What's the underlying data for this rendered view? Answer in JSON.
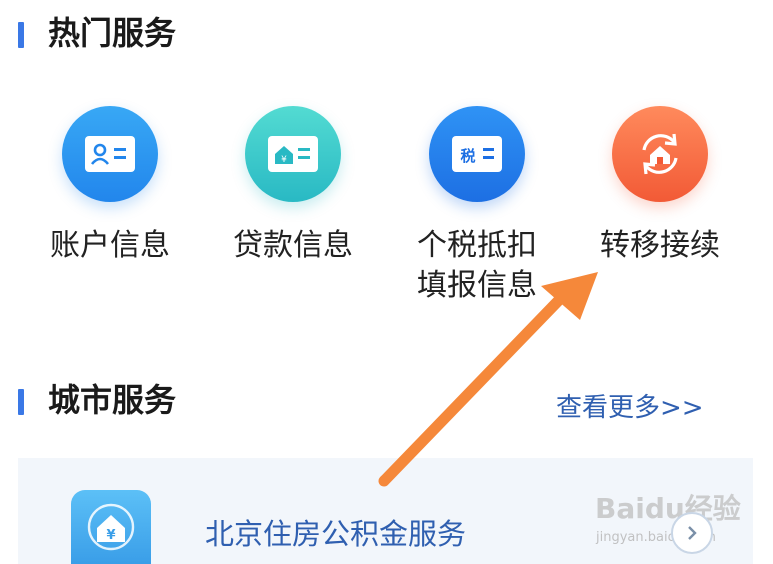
{
  "hot_services": {
    "title": "热门服务",
    "items": [
      {
        "label_lines": [
          "账户信息"
        ],
        "icon": "id-card-icon",
        "color_top": "#38a8f5",
        "color_bottom": "#2286ec"
      },
      {
        "label_lines": [
          "贷款信息"
        ],
        "icon": "loan-card-icon",
        "color_top": "#53dbd2",
        "color_bottom": "#29b9c4"
      },
      {
        "label_lines": [
          "个税抵扣",
          "填报信息"
        ],
        "icon": "tax-card-icon",
        "color_top": "#2f93f5",
        "color_bottom": "#1d6fe3"
      },
      {
        "label_lines": [
          "转移接续"
        ],
        "icon": "transfer-house-icon",
        "color_top": "#ff8a5c",
        "color_bottom": "#f25a36"
      }
    ]
  },
  "city_services": {
    "title": "城市服务",
    "more_link": "查看更多>>",
    "card_label": "北京住房公积金服务",
    "card_icon": "house-yuan-icon",
    "card_icon_glyph": "¥"
  },
  "tax_icon_glyph": "税",
  "annotation_arrow_color": "#f5883a",
  "accent_color": "#3a78e6",
  "watermark": {
    "brand": "Baidu经验",
    "url": "jingyan.baidu.com"
  }
}
